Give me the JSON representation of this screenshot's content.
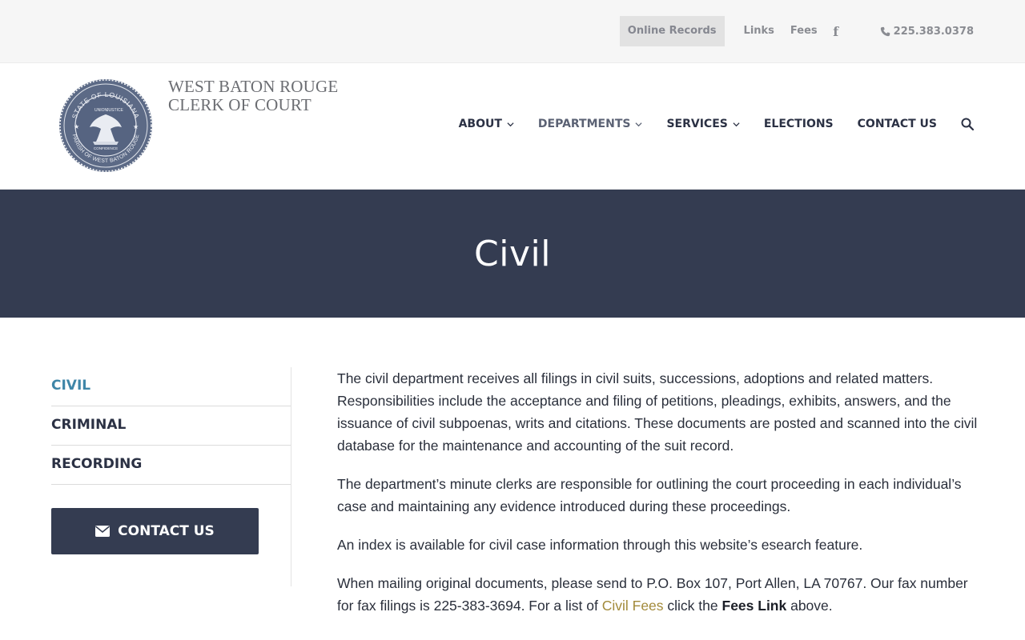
{
  "topbar": {
    "online_records": "Online Records",
    "links": "Links",
    "fees": "Fees",
    "facebook_glyph": "f",
    "phone": "225.383.0378"
  },
  "brand": {
    "line1": "WEST BATON ROUGE",
    "line2": "CLERK OF COURT",
    "seal_text_top": "STATE OF LOUISIANA",
    "seal_text_bottom": "PARISH OF WEST BATON ROUGE",
    "seal_union": "UNION",
    "seal_justice": "JUSTICE",
    "seal_confidence": "CONFIDENCE"
  },
  "nav": {
    "about": "ABOUT",
    "departments": "DEPARTMENTS",
    "services": "SERVICES",
    "elections": "ELECTIONS",
    "contact": "CONTACT US"
  },
  "hero": {
    "title": "Civil"
  },
  "sidebar": {
    "items": [
      "CIVIL",
      "CRIMINAL",
      "RECORDING"
    ],
    "contact_button": "CONTACT US"
  },
  "main": {
    "p1": "The civil department receives all filings in civil suits, successions, adoptions and related matters. Responsibilities include the acceptance and filing of petitions, pleadings, exhibits, answers, and the issuance of civil subpoenas, writs and citations. These documents are posted and scanned into the civil database for the maintenance and accounting of the suit record.",
    "p2": "The department’s minute clerks are responsible for outlining the court proceeding in each individual’s case and maintaining any evidence introduced during these proceedings.",
    "p3": "An index is available for civil case information through this website’s esearch feature.",
    "p4_a": "When mailing original documents, please send to P.O. Box 107, Port Allen, LA 70767.  Our fax number for fax filings is 225-383-3694.  For a list of ",
    "p4_link": "Civil Fees",
    "p4_b": " click the ",
    "p4_bold": "Fees Link",
    "p4_c": " above."
  },
  "colors": {
    "hero_bg": "#343c51",
    "active_link": "#3f86a8",
    "fees_link": "#a28a3a"
  }
}
